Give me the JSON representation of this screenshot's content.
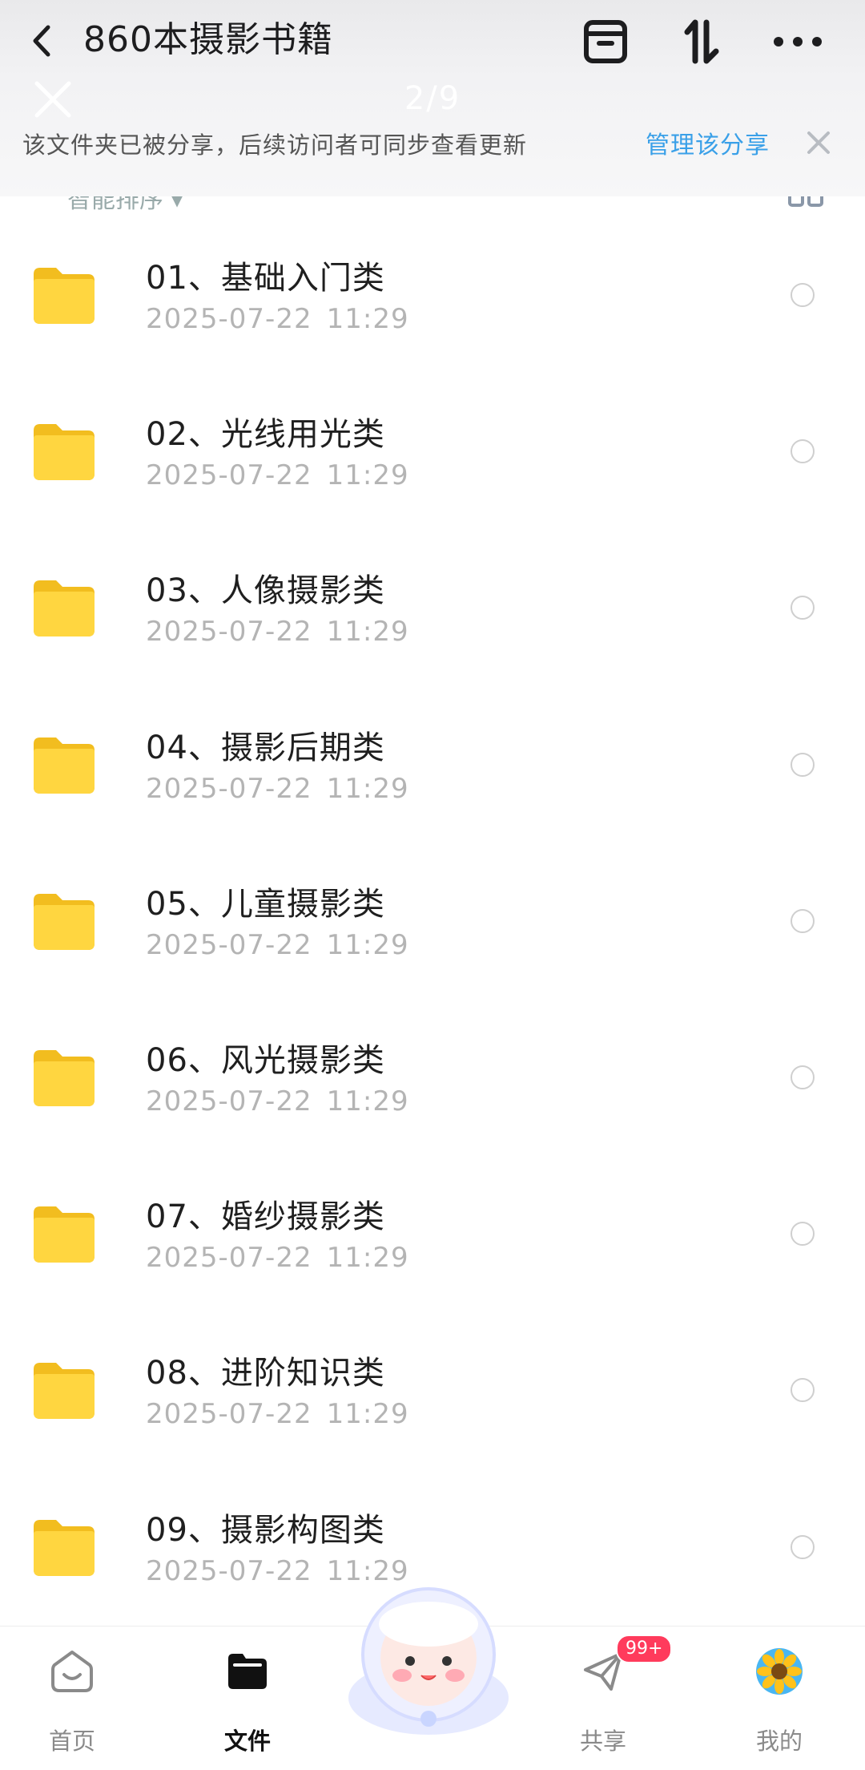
{
  "header": {
    "title": "860本摄影书籍",
    "page_indicator": "2/9"
  },
  "banner": {
    "text": "该文件夹已被分享，后续访问者可同步查看更新",
    "manage_label": "管理该分享"
  },
  "sort": {
    "label": "智能排序"
  },
  "files": [
    {
      "name": "01、基础入门类",
      "date": "2025-07-22",
      "time": "11:29"
    },
    {
      "name": "02、光线用光类",
      "date": "2025-07-22",
      "time": "11:29"
    },
    {
      "name": "03、人像摄影类",
      "date": "2025-07-22",
      "time": "11:29"
    },
    {
      "name": "04、摄影后期类",
      "date": "2025-07-22",
      "time": "11:29"
    },
    {
      "name": "05、儿童摄影类",
      "date": "2025-07-22",
      "time": "11:29"
    },
    {
      "name": "06、风光摄影类",
      "date": "2025-07-22",
      "time": "11:29"
    },
    {
      "name": "07、婚纱摄影类",
      "date": "2025-07-22",
      "time": "11:29"
    },
    {
      "name": "08、进阶知识类",
      "date": "2025-07-22",
      "time": "11:29"
    },
    {
      "name": "09、摄影构图类",
      "date": "2025-07-22",
      "time": "11:29"
    }
  ],
  "nav": {
    "home": "首页",
    "files": "文件",
    "share": "共享",
    "share_badge": "99+",
    "me": "我的"
  },
  "colors": {
    "accent": "#3aa0e8",
    "folder": "#ffd23c",
    "badge": "#ff3b5c"
  },
  "icons": [
    "chevron-left-icon",
    "box-icon",
    "sort-icon",
    "more-icon",
    "close-icon",
    "folder-icon",
    "home-icon",
    "files-icon",
    "share-icon",
    "avatar-sunflower-icon",
    "mascot-icon"
  ]
}
